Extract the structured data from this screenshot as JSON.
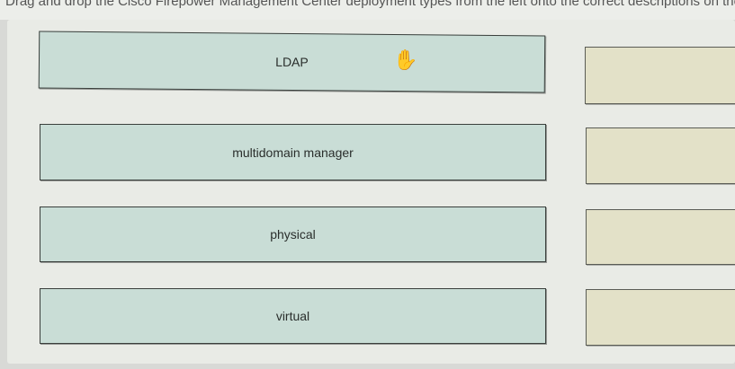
{
  "header": {
    "instruction_text": "Drag and drop the Cisco Firepower Management Center deployment types from the left onto the correct descriptions on the right."
  },
  "drag_items": [
    {
      "label": "LDAP"
    },
    {
      "label": "multidomain manager"
    },
    {
      "label": "physical"
    },
    {
      "label": "virtual"
    }
  ],
  "cursor": {
    "icon": "hand-cursor-icon"
  },
  "colors": {
    "item_fill": "#c9ddd6",
    "target_fill": "#e3e1c8",
    "border": "#3a3f3c"
  }
}
